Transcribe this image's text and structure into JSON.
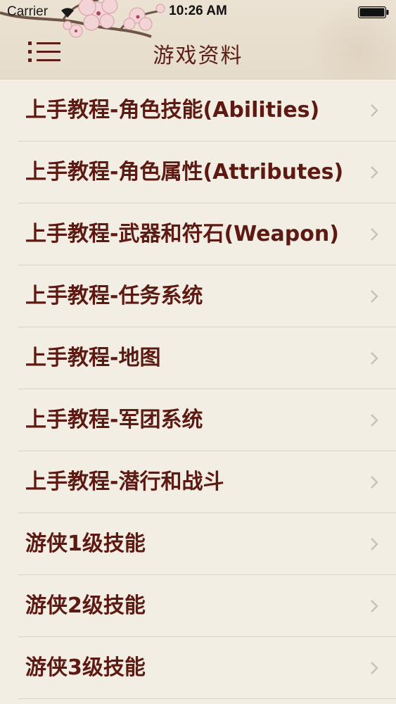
{
  "status_bar": {
    "carrier": "Carrier",
    "time": "10:26 AM"
  },
  "nav": {
    "title": "游戏资料",
    "menu_icon": "hamburger-menu-icon"
  },
  "list": {
    "items": [
      {
        "label": "上手教程-角色技能(Abilities)"
      },
      {
        "label": "上手教程-角色属性(Attributes)"
      },
      {
        "label": "上手教程-武器和符石(Weapon)"
      },
      {
        "label": "上手教程-任务系统"
      },
      {
        "label": "上手教程-地图"
      },
      {
        "label": "上手教程-军团系统"
      },
      {
        "label": "上手教程-潜行和战斗"
      },
      {
        "label": "游侠1级技能"
      },
      {
        "label": "游侠2级技能"
      },
      {
        "label": "游侠3级技能"
      }
    ]
  },
  "colors": {
    "title": "#5c1e15",
    "row_text": "#5d1a12",
    "background": "#f3eee4",
    "chevron": "#c7c0b8"
  }
}
